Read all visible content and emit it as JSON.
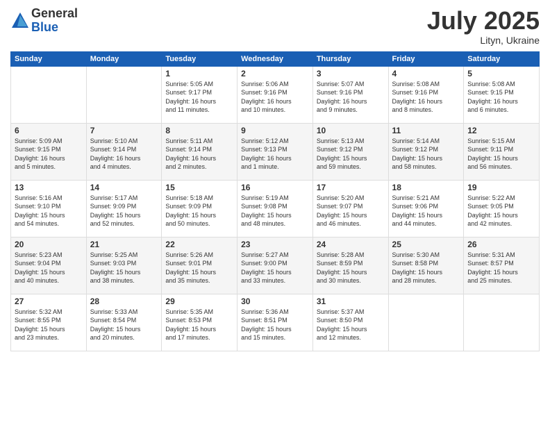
{
  "logo": {
    "general": "General",
    "blue": "Blue"
  },
  "title": "July 2025",
  "subtitle": "Lityn, Ukraine",
  "weekdays": [
    "Sunday",
    "Monday",
    "Tuesday",
    "Wednesday",
    "Thursday",
    "Friday",
    "Saturday"
  ],
  "weeks": [
    [
      {
        "day": "",
        "info": ""
      },
      {
        "day": "",
        "info": ""
      },
      {
        "day": "1",
        "info": "Sunrise: 5:05 AM\nSunset: 9:17 PM\nDaylight: 16 hours\nand 11 minutes."
      },
      {
        "day": "2",
        "info": "Sunrise: 5:06 AM\nSunset: 9:16 PM\nDaylight: 16 hours\nand 10 minutes."
      },
      {
        "day": "3",
        "info": "Sunrise: 5:07 AM\nSunset: 9:16 PM\nDaylight: 16 hours\nand 9 minutes."
      },
      {
        "day": "4",
        "info": "Sunrise: 5:08 AM\nSunset: 9:16 PM\nDaylight: 16 hours\nand 8 minutes."
      },
      {
        "day": "5",
        "info": "Sunrise: 5:08 AM\nSunset: 9:15 PM\nDaylight: 16 hours\nand 6 minutes."
      }
    ],
    [
      {
        "day": "6",
        "info": "Sunrise: 5:09 AM\nSunset: 9:15 PM\nDaylight: 16 hours\nand 5 minutes."
      },
      {
        "day": "7",
        "info": "Sunrise: 5:10 AM\nSunset: 9:14 PM\nDaylight: 16 hours\nand 4 minutes."
      },
      {
        "day": "8",
        "info": "Sunrise: 5:11 AM\nSunset: 9:14 PM\nDaylight: 16 hours\nand 2 minutes."
      },
      {
        "day": "9",
        "info": "Sunrise: 5:12 AM\nSunset: 9:13 PM\nDaylight: 16 hours\nand 1 minute."
      },
      {
        "day": "10",
        "info": "Sunrise: 5:13 AM\nSunset: 9:12 PM\nDaylight: 15 hours\nand 59 minutes."
      },
      {
        "day": "11",
        "info": "Sunrise: 5:14 AM\nSunset: 9:12 PM\nDaylight: 15 hours\nand 58 minutes."
      },
      {
        "day": "12",
        "info": "Sunrise: 5:15 AM\nSunset: 9:11 PM\nDaylight: 15 hours\nand 56 minutes."
      }
    ],
    [
      {
        "day": "13",
        "info": "Sunrise: 5:16 AM\nSunset: 9:10 PM\nDaylight: 15 hours\nand 54 minutes."
      },
      {
        "day": "14",
        "info": "Sunrise: 5:17 AM\nSunset: 9:09 PM\nDaylight: 15 hours\nand 52 minutes."
      },
      {
        "day": "15",
        "info": "Sunrise: 5:18 AM\nSunset: 9:09 PM\nDaylight: 15 hours\nand 50 minutes."
      },
      {
        "day": "16",
        "info": "Sunrise: 5:19 AM\nSunset: 9:08 PM\nDaylight: 15 hours\nand 48 minutes."
      },
      {
        "day": "17",
        "info": "Sunrise: 5:20 AM\nSunset: 9:07 PM\nDaylight: 15 hours\nand 46 minutes."
      },
      {
        "day": "18",
        "info": "Sunrise: 5:21 AM\nSunset: 9:06 PM\nDaylight: 15 hours\nand 44 minutes."
      },
      {
        "day": "19",
        "info": "Sunrise: 5:22 AM\nSunset: 9:05 PM\nDaylight: 15 hours\nand 42 minutes."
      }
    ],
    [
      {
        "day": "20",
        "info": "Sunrise: 5:23 AM\nSunset: 9:04 PM\nDaylight: 15 hours\nand 40 minutes."
      },
      {
        "day": "21",
        "info": "Sunrise: 5:25 AM\nSunset: 9:03 PM\nDaylight: 15 hours\nand 38 minutes."
      },
      {
        "day": "22",
        "info": "Sunrise: 5:26 AM\nSunset: 9:01 PM\nDaylight: 15 hours\nand 35 minutes."
      },
      {
        "day": "23",
        "info": "Sunrise: 5:27 AM\nSunset: 9:00 PM\nDaylight: 15 hours\nand 33 minutes."
      },
      {
        "day": "24",
        "info": "Sunrise: 5:28 AM\nSunset: 8:59 PM\nDaylight: 15 hours\nand 30 minutes."
      },
      {
        "day": "25",
        "info": "Sunrise: 5:30 AM\nSunset: 8:58 PM\nDaylight: 15 hours\nand 28 minutes."
      },
      {
        "day": "26",
        "info": "Sunrise: 5:31 AM\nSunset: 8:57 PM\nDaylight: 15 hours\nand 25 minutes."
      }
    ],
    [
      {
        "day": "27",
        "info": "Sunrise: 5:32 AM\nSunset: 8:55 PM\nDaylight: 15 hours\nand 23 minutes."
      },
      {
        "day": "28",
        "info": "Sunrise: 5:33 AM\nSunset: 8:54 PM\nDaylight: 15 hours\nand 20 minutes."
      },
      {
        "day": "29",
        "info": "Sunrise: 5:35 AM\nSunset: 8:53 PM\nDaylight: 15 hours\nand 17 minutes."
      },
      {
        "day": "30",
        "info": "Sunrise: 5:36 AM\nSunset: 8:51 PM\nDaylight: 15 hours\nand 15 minutes."
      },
      {
        "day": "31",
        "info": "Sunrise: 5:37 AM\nSunset: 8:50 PM\nDaylight: 15 hours\nand 12 minutes."
      },
      {
        "day": "",
        "info": ""
      },
      {
        "day": "",
        "info": ""
      }
    ]
  ]
}
